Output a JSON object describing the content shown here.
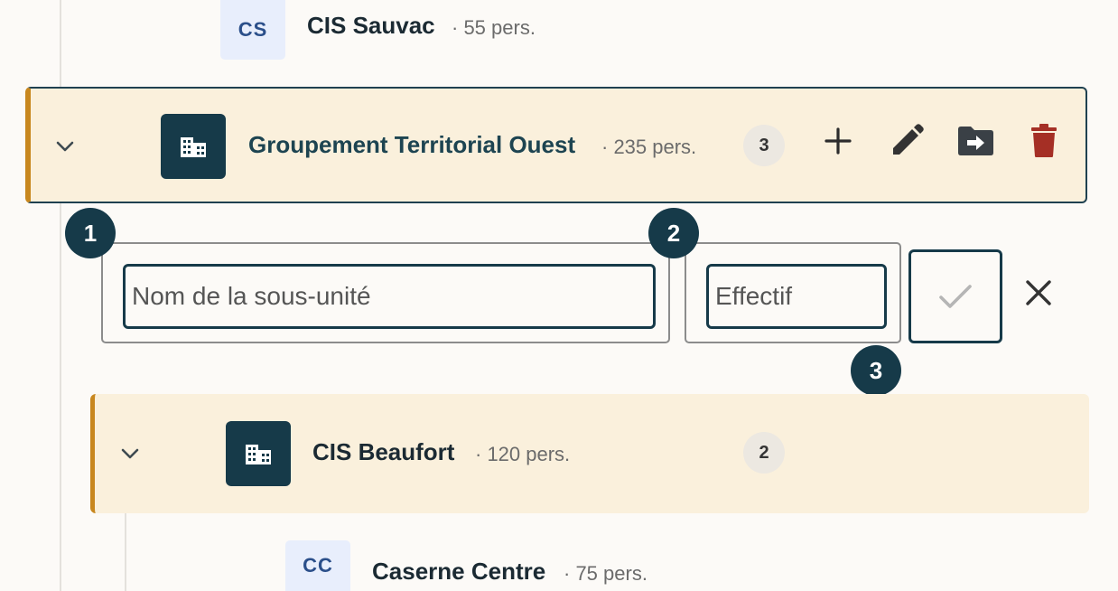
{
  "tree": {
    "leaf_top": {
      "initials": "CS",
      "name": "CIS Sauvac",
      "meta": "· 55 pers."
    },
    "group": {
      "name": "Groupement Territorial Ouest",
      "meta": "· 235 pers.",
      "count": "3",
      "actions": [
        "add-icon",
        "edit-icon",
        "move-to-folder-icon",
        "delete-icon"
      ]
    },
    "subgroup": {
      "name": "CIS Beaufort",
      "meta": "· 120 pers.",
      "count": "2"
    },
    "leaf_bottom": {
      "initials": "CC",
      "name": "Caserne Centre",
      "meta": "· 75 pers."
    }
  },
  "form": {
    "name_placeholder": "Nom de la sous-unité",
    "effectif_placeholder": "Effectif"
  },
  "annotations": [
    "1",
    "2",
    "3"
  ],
  "colors": {
    "accent_dark": "#163a49",
    "row_bg": "#faf0dc",
    "row_border_left": "#c8871e",
    "delete": "#a52f25",
    "avatar_bg": "#e8eefc"
  }
}
